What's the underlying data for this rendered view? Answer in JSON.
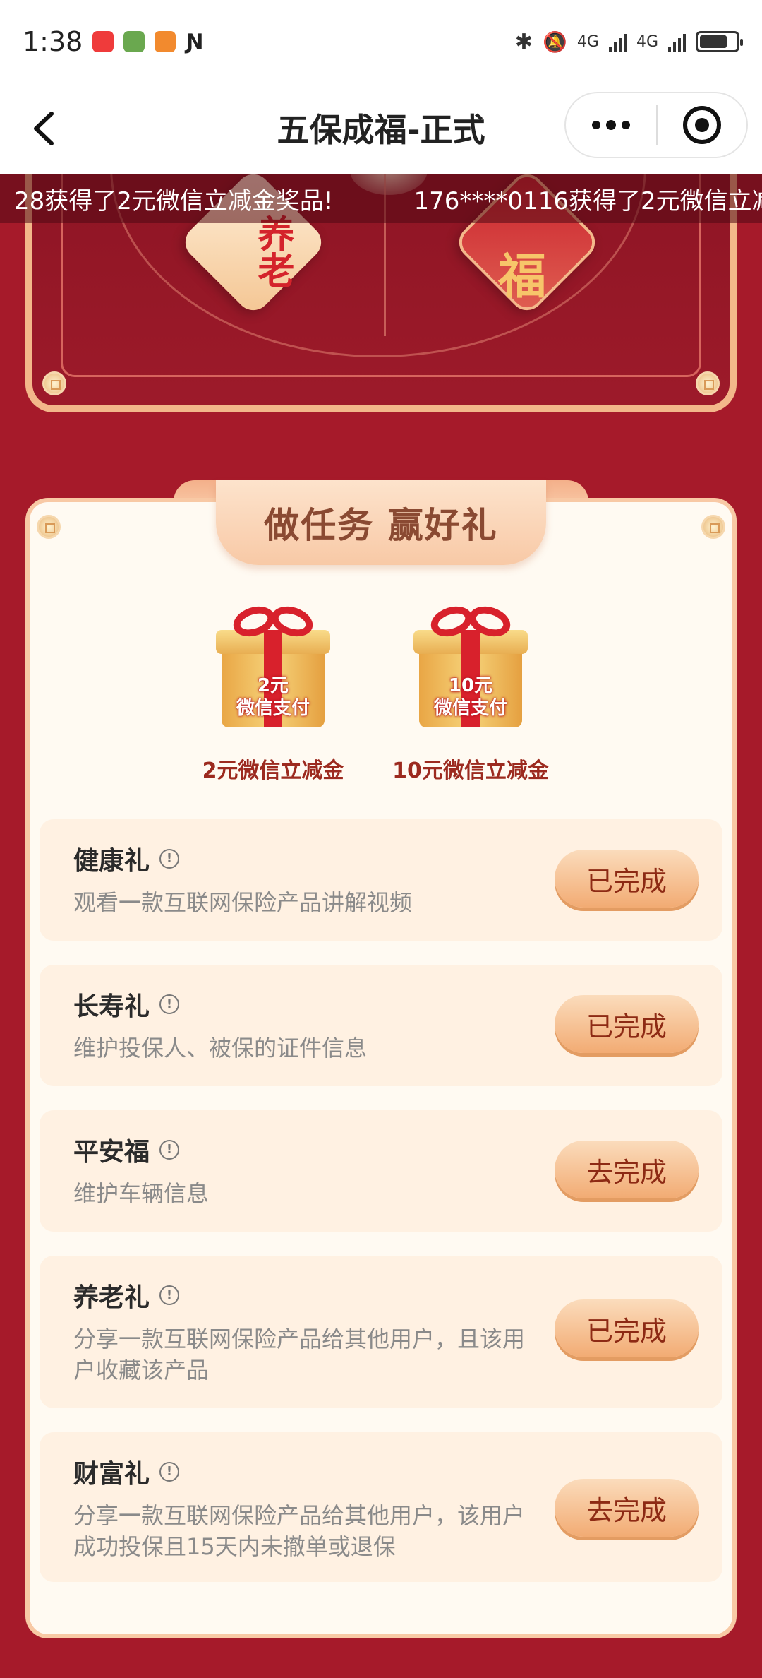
{
  "statusbar": {
    "time": "1:38",
    "network1": "4G",
    "network2": "4G",
    "battery_percent": 75
  },
  "navbar": {
    "title": "五保成福-正式"
  },
  "banner": {
    "left_tile": "养老",
    "right_tile": "福"
  },
  "ticker": {
    "messages": [
      "28获得了2元微信立减金奖品!",
      "176****0116获得了2元微信立减"
    ]
  },
  "card": {
    "header": "做任务 赢好礼",
    "gifts": [
      {
        "amount": "2元",
        "sub": "微信支付",
        "caption": "2元微信立减金"
      },
      {
        "amount": "10元",
        "sub": "微信支付",
        "caption": "10元微信立减金"
      }
    ],
    "tasks": [
      {
        "title": "健康礼",
        "desc": "观看一款互联网保险产品讲解视频",
        "button": "已完成"
      },
      {
        "title": "长寿礼",
        "desc": "维护投保人、被保的证件信息",
        "button": "已完成"
      },
      {
        "title": "平安福",
        "desc": "维护车辆信息",
        "button": "去完成"
      },
      {
        "title": "养老礼",
        "desc": "分享一款互联网保险产品给其他用户，且该用户收藏该产品",
        "button": "已完成"
      },
      {
        "title": "财富礼",
        "desc": "分享一款互联网保险产品给其他用户，该用户成功投保且15天内未撤单或退保",
        "button": "去完成"
      }
    ]
  },
  "colors": {
    "background": "#a61a2a",
    "accent": "#f2ab73",
    "button_text": "#8d2a14"
  }
}
